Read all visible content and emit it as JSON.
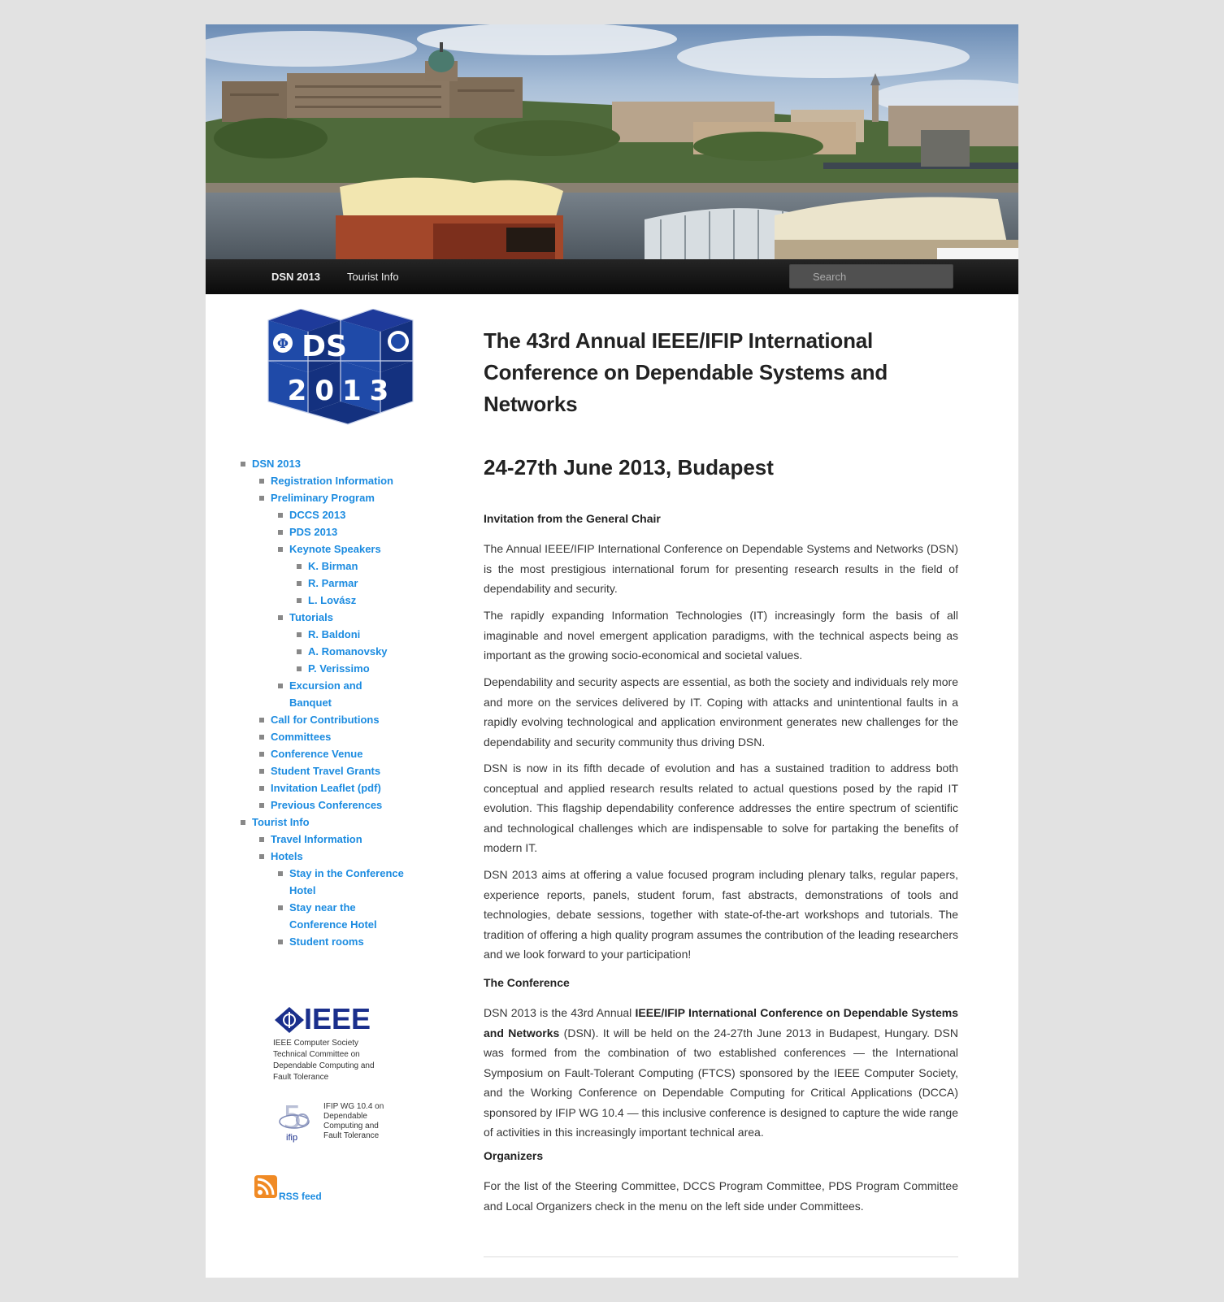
{
  "nav": {
    "items": [
      {
        "label": "DSN 2013",
        "active": true
      },
      {
        "label": "Tourist Info",
        "active": false
      }
    ],
    "search_placeholder": "Search"
  },
  "sidebar": {
    "logo_text": {
      "top": "DS",
      "bottom": "2013"
    },
    "menu": {
      "dsn2013": "DSN 2013",
      "registration": "Registration Information",
      "program": "Preliminary Program",
      "dccs": "DCCS 2013",
      "pds": "PDS 2013",
      "keynote": "Keynote Speakers",
      "birman": "K. Birman",
      "parmar": "R. Parmar",
      "lovasz": "L. Lovász",
      "tutorials": "Tutorials",
      "baldoni": "R. Baldoni",
      "romanovsky": "A. Romanovsky",
      "verissimo": "P. Verissimo",
      "excursion": "Excursion and Banquet",
      "call": "Call for Contributions",
      "committees": "Committees",
      "venue": "Conference Venue",
      "grants": "Student Travel Grants",
      "leaflet": "Invitation Leaflet (pdf)",
      "previous": "Previous Conferences",
      "tourist": "Tourist Info",
      "travel": "Travel Information",
      "hotels": "Hotels",
      "stay_in": "Stay in the Conference Hotel",
      "stay_near": "Stay near the Conference Hotel",
      "student_rooms": "Student rooms"
    },
    "ieee": {
      "logo": "IEEE",
      "caption": [
        "IEEE Computer Society",
        "Technical Committee on",
        "Dependable Computing and",
        "Fault Tolerance"
      ]
    },
    "ifip": {
      "logo": "ifip",
      "caption": [
        "IFIP WG 10.4 on",
        "Dependable",
        "Computing and",
        "Fault Tolerance"
      ]
    },
    "rss_label": "RSS feed"
  },
  "content": {
    "title": "The 43rd Annual IEEE/IFIP International Conference on Dependable Systems and Networks",
    "subtitle": "24-27th June 2013, Budapest",
    "invitation_heading": "Invitation from the General Chair",
    "p1": "The Annual IEEE/IFIP International Conference on Dependable Systems and Networks (DSN) is the most prestigious international forum for presenting research results in the field of dependability and security.",
    "p2": "The rapidly expanding Information Technologies (IT) increasingly form the basis of all imaginable and novel emergent application paradigms, with the technical aspects being as important as the growing socio-economical and societal values.",
    "p3": "Dependability and security aspects are essential, as both the society and individuals rely more and more on the services delivered by IT. Coping with attacks and unintentional faults in a rapidly evolving technological and application environment generates new challenges for the dependability and security community thus driving DSN.",
    "p4": "DSN is now in its fifth decade of evolution and has a sustained tradition to address both conceptual and applied research results related to actual questions posed by the rapid IT evolution. This flagship dependability conference addresses the entire spectrum of scientific and technological challenges which are indispensable to  solve for partaking the benefits of modern IT.",
    "p5": "DSN 2013 aims at offering a value focused program including plenary talks, regular papers, experience reports, panels, student forum, fast abstracts, demonstrations of tools and technologies, debate sessions, together with state-of-the-art workshops and tutorials. The tradition of offering a high quality program assumes the contribution of the leading researchers and we look forward to your participation!",
    "conference_heading": "The Conference",
    "conf_a": "DSN 2013 is the 43rd Annual ",
    "conf_strong": "IEEE/IFIP International Conference on Dependable Systems and Networks",
    "conf_b": " (DSN). It will be held on the 24-27th June 2013 in Budapest, Hungary. DSN was formed from the combination of two established conferences — the International Symposium on Fault-Tolerant Computing (FTCS) sponsored by the IEEE Computer Society, and the Working Conference on Dependable Computing for Critical Applications (DCCA) sponsored by IFIP WG 10.4 — this inclusive conference is designed to capture the wide range of activities in this increasingly important technical area.",
    "organizers_heading": "Organizers",
    "organizers_text": "For the list of the Steering Committee, DCCS Program Committee, PDS Program Committee and Local Organizers check in the menu on the left side under Committees."
  }
}
